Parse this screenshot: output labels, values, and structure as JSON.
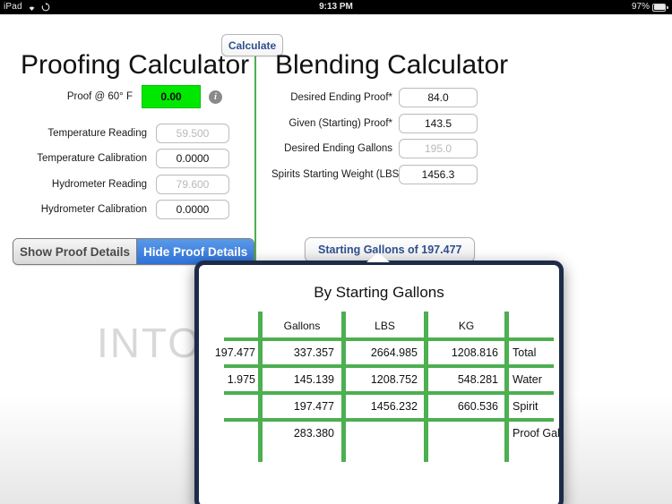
{
  "status_bar": {
    "carrier": "iPad",
    "wifi_icon": "wifi-icon",
    "sync_icon": "sync-icon",
    "time": "9:13 PM",
    "battery_percent": "97%",
    "battery_icon": "battery-icon"
  },
  "toolbar": {
    "calculate_label": "Calculate"
  },
  "watermark": "INTO",
  "proofing": {
    "title": "Proofing Calculator",
    "proof_label": "Proof @ 60° F",
    "proof_value": "0.00",
    "proof_value_color": "#00e800",
    "info_icon": "info-icon",
    "fields": [
      {
        "label": "Temperature Reading",
        "value": "59.500",
        "is_placeholder": true
      },
      {
        "label": "Temperature Calibration",
        "value": "0.0000",
        "is_placeholder": false
      },
      {
        "label": "Hydrometer Reading",
        "value": "79.600",
        "is_placeholder": true
      },
      {
        "label": "Hydrometer Calibration",
        "value": "0.0000",
        "is_placeholder": false
      }
    ],
    "segmented": {
      "show_label": "Show Proof Details",
      "hide_label": "Hide Proof Details",
      "selected": "Hide Proof Details",
      "selected_color": "#2f71d8"
    }
  },
  "blending": {
    "title": "Blending Calculator",
    "fields": [
      {
        "label": "Desired Ending Proof*",
        "value": "84.0",
        "is_placeholder": false
      },
      {
        "label": "Given (Starting) Proof*",
        "value": "143.5",
        "is_placeholder": false
      },
      {
        "label": "Desired Ending Gallons",
        "value": "195.0",
        "is_placeholder": true
      },
      {
        "label": "Spirits Starting Weight (LBS)",
        "value": "1456.3",
        "is_placeholder": false
      }
    ],
    "starting_gallons_button": "Starting Gallons of 197.477"
  },
  "popover": {
    "title": "By Starting Gallons",
    "grid_color": "#4caf50",
    "border_color": "#1d2b49",
    "columns": [
      "",
      "Gallons",
      "LBS",
      "KG",
      ""
    ],
    "rows": [
      {
        "c0": "197.477",
        "c1": "337.357",
        "c2": "2664.985",
        "c3": "1208.816",
        "label": "Total"
      },
      {
        "c0": "1.975",
        "c1": "145.139",
        "c2": "1208.752",
        "c3": "548.281",
        "label": "Water"
      },
      {
        "c0": "",
        "c1": "197.477",
        "c2": "1456.232",
        "c3": "660.536",
        "label": "Spirit"
      },
      {
        "c0": "",
        "c1": "283.380",
        "c2": "",
        "c3": "",
        "label": "Proof Gal"
      }
    ]
  }
}
